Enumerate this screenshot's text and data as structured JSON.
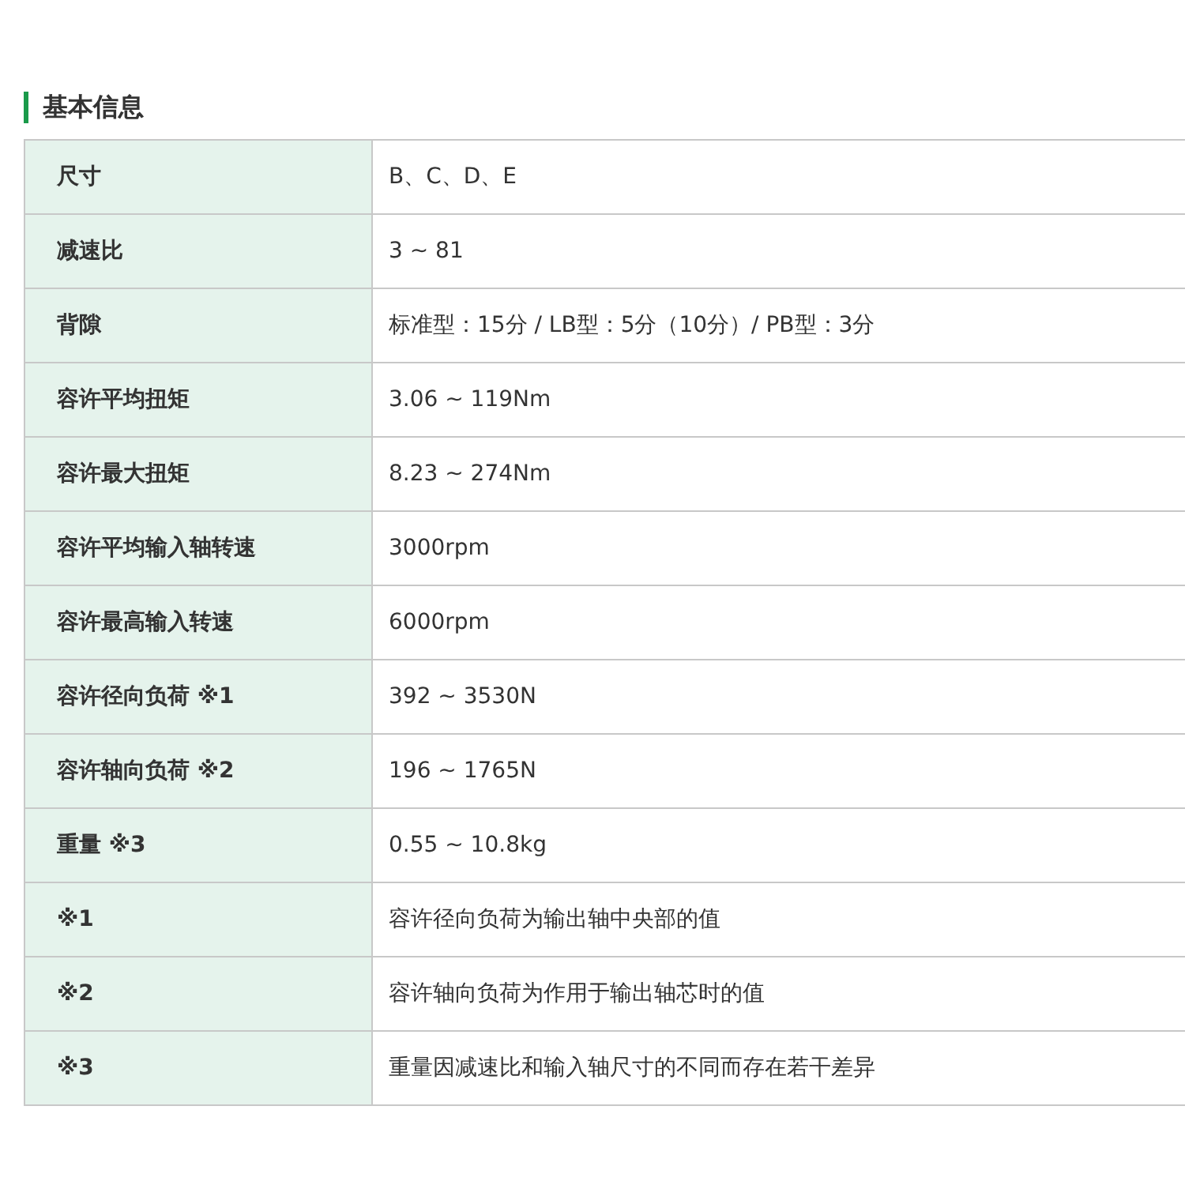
{
  "section": {
    "title": "基本信息"
  },
  "rows": [
    {
      "label": "尺寸",
      "value": "B、C、D、E"
    },
    {
      "label": "减速比",
      "value": "3 ~ 81"
    },
    {
      "label": "背隙",
      "value": "标准型：15分 / LB型：5分（10分）/ PB型：3分"
    },
    {
      "label": "容许平均扭矩",
      "value": "3.06 ~ 119Nm"
    },
    {
      "label": "容许最大扭矩",
      "value": "8.23 ~ 274Nm"
    },
    {
      "label": "容许平均输入轴转速",
      "value": "3000rpm"
    },
    {
      "label": "容许最高输入转速",
      "value": "6000rpm"
    },
    {
      "label": "容许径向负荷 ※1",
      "value": "392 ~ 3530N"
    },
    {
      "label": "容许轴向负荷 ※2",
      "value": "196 ~ 1765N"
    },
    {
      "label": "重量 ※3",
      "value": "0.55 ~ 10.8kg"
    },
    {
      "label": "※1",
      "value": "容许径向负荷为输出轴中央部的值"
    },
    {
      "label": "※2",
      "value": "容许轴向负荷为作用于输出轴芯时的值"
    },
    {
      "label": "※3",
      "value": "重量因减速比和输入轴尺寸的不同而存在若干差异"
    }
  ]
}
